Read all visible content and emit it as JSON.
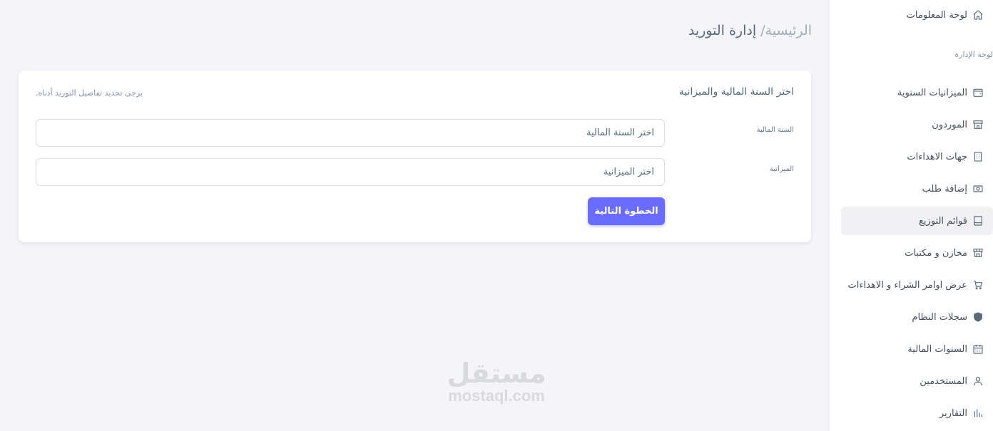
{
  "sidebar": {
    "dashboard_label": "لوحة المعلومات",
    "section_label": "لوحة الإدارة",
    "items": [
      {
        "label": "الميزانيات السنوية",
        "icon": "wallet-icon"
      },
      {
        "label": "الموردون",
        "icon": "store-icon"
      },
      {
        "label": "جهات الاهداءات",
        "icon": "building-icon"
      },
      {
        "label": "إضافة طلب",
        "icon": "cash-icon"
      },
      {
        "label": "قوائم التوزيع",
        "icon": "book-icon"
      },
      {
        "label": "مخازن و مكتبات",
        "icon": "warehouse-icon"
      },
      {
        "label": "عرض اوامر الشراء و الاهداءات",
        "icon": "cart-icon"
      },
      {
        "label": "سجلات النظام",
        "icon": "shield-icon"
      },
      {
        "label": "السنوات المالية",
        "icon": "calendar-icon"
      },
      {
        "label": "المستخدمين",
        "icon": "user-icon"
      },
      {
        "label": "التقارير",
        "icon": "bar-chart-icon"
      }
    ],
    "active_item": "قوائم التوزيع"
  },
  "breadcrumb": {
    "home": "الرئيسية/",
    "current": "إدارة التوريد"
  },
  "card": {
    "title": "اختر السنة المالية والميزانية",
    "hint": "يرجى تحديد تفاصيل التوريد أدناه.",
    "fiscal_year": {
      "label": "السنة المالية",
      "placeholder": "اختر السنة المالية"
    },
    "budget": {
      "label": "الميزانية",
      "placeholder": "اختر الميزانية"
    },
    "next_button": "الخطوة التالية"
  },
  "watermark": {
    "arabic": "مستقل",
    "latin": "mostaql.com"
  },
  "colors": {
    "accent": "#696cff",
    "background": "#f5f5f9",
    "card": "#ffffff",
    "text": "#566a7f"
  }
}
